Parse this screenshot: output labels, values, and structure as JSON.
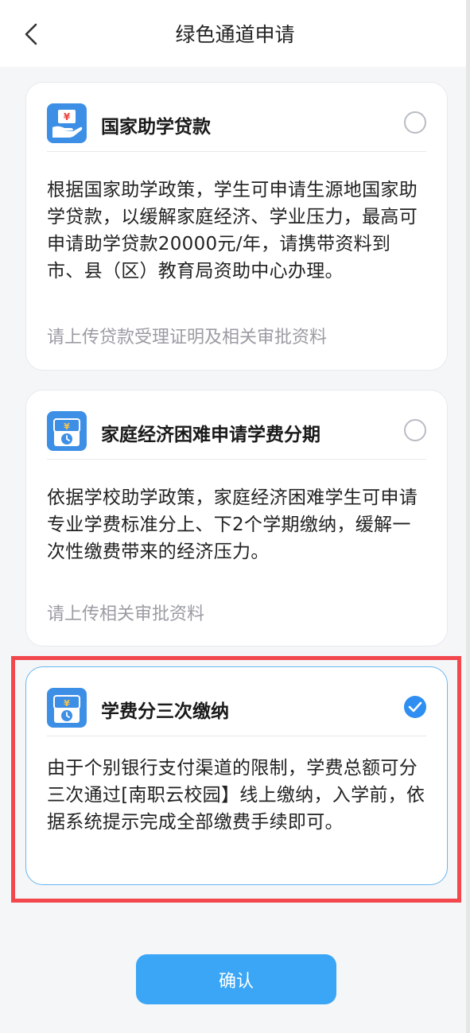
{
  "header": {
    "title": "绿色通道申请",
    "back_icon": "chevron-left-icon"
  },
  "options": [
    {
      "icon": "loan-hand-icon",
      "title": "国家助学贷款",
      "description": "根据国家助学政策，学生可申请生源地国家助学贷款，以缓解家庭经济、学业压力，最高可申请助学贷款20000元/年，请携带资料到市、县（区）教育局资助中心办理。",
      "note": "请上传贷款受理证明及相关审批资料",
      "selected": false
    },
    {
      "icon": "installment-clock-icon",
      "title": "家庭经济困难申请学费分期",
      "description": "依据学校助学政策，家庭经济困难学生可申请专业学费标准分上、下2个学期缴纳，缓解一次性缴费带来的经济压力。",
      "note": "请上传相关审批资料",
      "selected": false
    },
    {
      "icon": "installment-clock-icon",
      "title": "学费分三次缴纳",
      "description": "由于个别银行支付渠道的限制，学费总额可分三次通过[南职云校园】线上缴纳，入学前，依据系统提示完成全部缴费手续即可。",
      "note": "",
      "selected": true
    }
  ],
  "confirm_label": "确认",
  "colors": {
    "accent": "#3aa6f5",
    "checked": "#2e8ef2",
    "highlight_frame": "#f1474d",
    "note_text": "#9a9ca3"
  }
}
